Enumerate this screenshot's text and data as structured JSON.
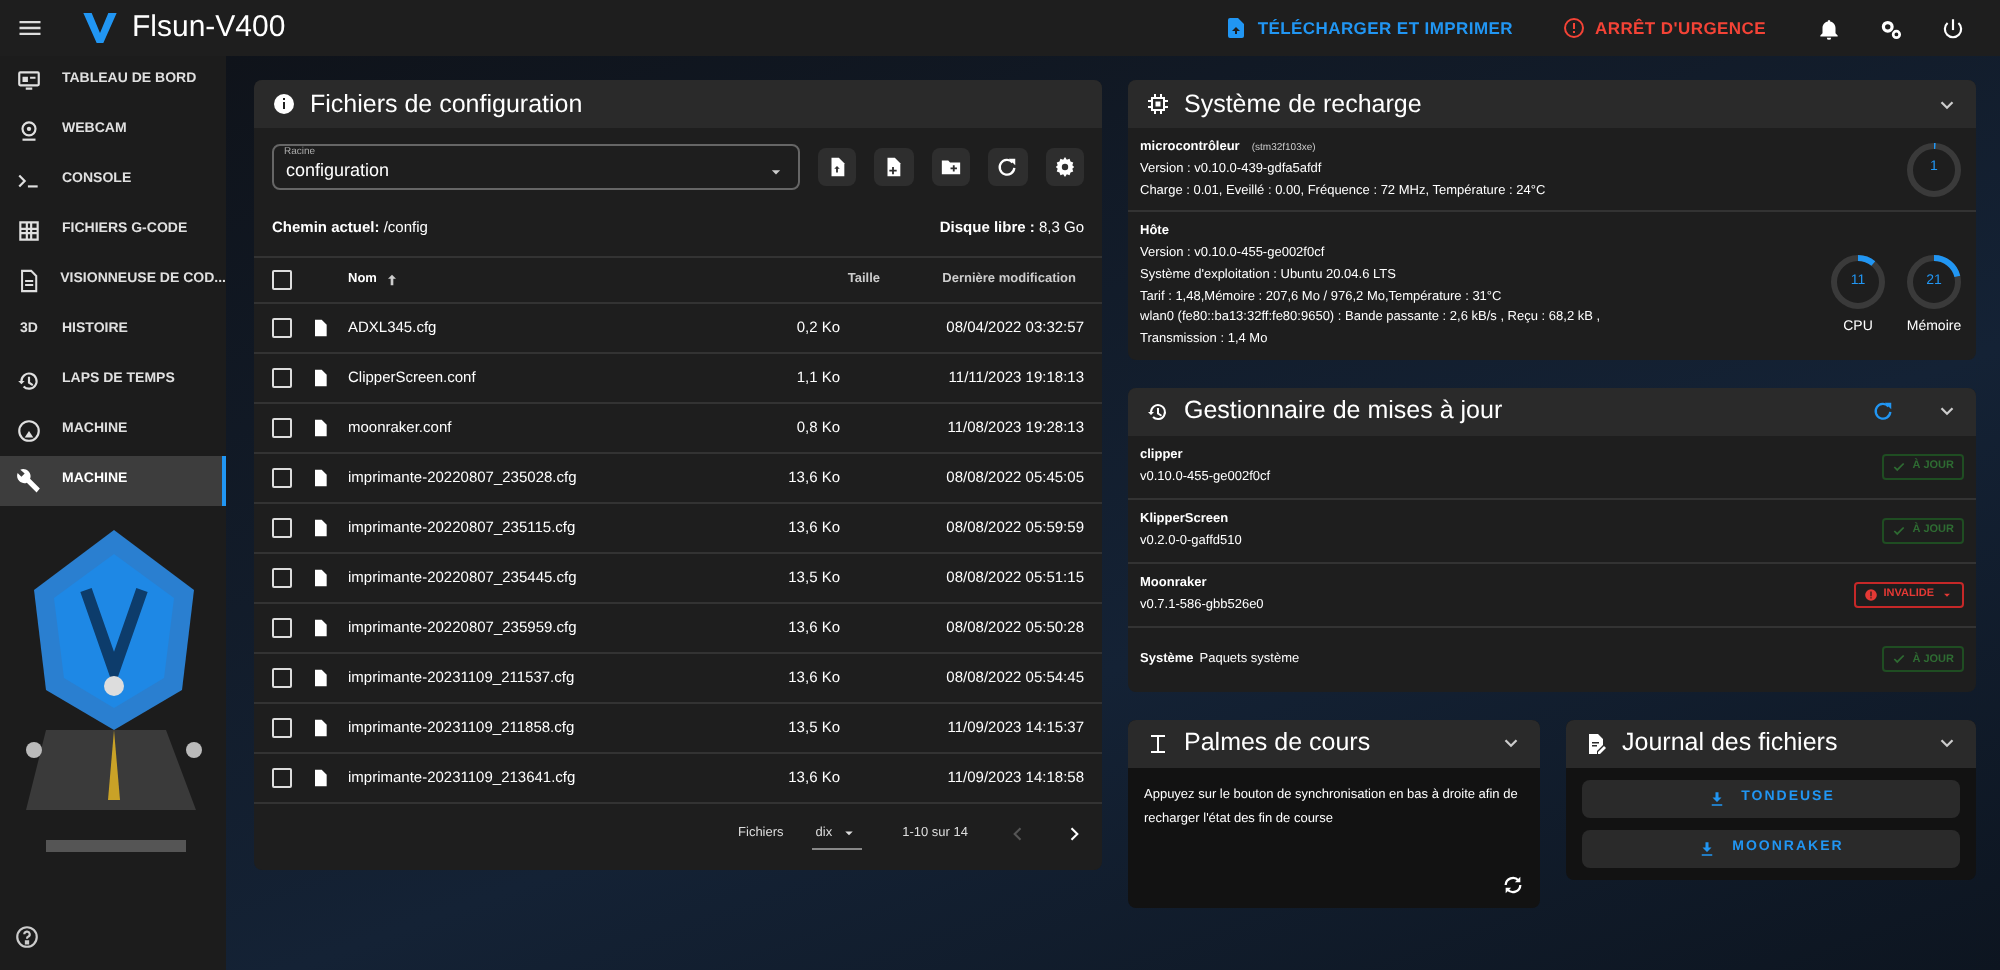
{
  "app": {
    "title": "Flsun-V400"
  },
  "top_actions": [
    {
      "label": "TÉLÉCHARGER ET IMPRIMER",
      "kind": "upload"
    },
    {
      "label": "ARRÊT D'URGENCE",
      "kind": "stop"
    }
  ],
  "sidebar": {
    "items": [
      {
        "label": "TABLEAU DE BORD",
        "selected": false
      },
      {
        "label": "WEBCAM",
        "selected": false
      },
      {
        "label": "CONSOLE",
        "selected": false
      },
      {
        "label": "FICHIERS G-CODE",
        "selected": false
      },
      {
        "label": "VISIONNEUSE DE COD...",
        "selected": false
      },
      {
        "label": "HISTOIRE",
        "icon_text": "3D",
        "selected": false
      },
      {
        "label": "LAPS DE TEMPS",
        "selected": false
      },
      {
        "label": "MACHINE",
        "selected": false
      },
      {
        "label": "MACHINE",
        "selected": true
      }
    ]
  },
  "files_panel": {
    "title": "Fichiers de configuration",
    "root_select": {
      "label": "Racine",
      "value": "configuration"
    },
    "current_path_label": "Chemin actuel:",
    "current_path": "/config",
    "free_disk_label": "Disque libre :",
    "free_disk": "8,3 Go",
    "table": {
      "select_all_checked": false,
      "columns": [
        {
          "label": "Nom",
          "sorted": true
        },
        {
          "label": "Taille",
          "sorted": false
        },
        {
          "label": "Dernière modification",
          "sorted": false
        }
      ],
      "rows": [
        {
          "name": "ADXL345.cfg",
          "size": "0,2 Ko",
          "modified": "08/04/2022 03:32:57",
          "checked": false
        },
        {
          "name": "ClipperScreen.conf",
          "size": "1,1 Ko",
          "modified": "11/11/2023 19:18:13",
          "checked": false
        },
        {
          "name": "moonraker.conf",
          "size": "0,8 Ko",
          "modified": "11/08/2023 19:28:13",
          "checked": false
        },
        {
          "name": "imprimante-20220807_235028.cfg",
          "size": "13,6 Ko",
          "modified": "08/08/2022 05:45:05",
          "checked": false
        },
        {
          "name": "imprimante-20220807_235115.cfg",
          "size": "13,6 Ko",
          "modified": "08/08/2022 05:59:59",
          "checked": false
        },
        {
          "name": "imprimante-20220807_235445.cfg",
          "size": "13,5 Ko",
          "modified": "08/08/2022 05:51:15",
          "checked": false
        },
        {
          "name": "imprimante-20220807_235959.cfg",
          "size": "13,6 Ko",
          "modified": "08/08/2022 05:50:28",
          "checked": false
        },
        {
          "name": "imprimante-20231109_211537.cfg",
          "size": "13,6 Ko",
          "modified": "08/08/2022 05:54:45",
          "checked": false
        },
        {
          "name": "imprimante-20231109_211858.cfg",
          "size": "13,5 Ko",
          "modified": "11/09/2023 14:15:37",
          "checked": false
        },
        {
          "name": "imprimante-20231109_213641.cfg",
          "size": "13,6 Ko",
          "modified": "11/09/2023 14:18:58",
          "checked": false
        }
      ]
    },
    "footer": {
      "rows_label": "Fichiers",
      "rows_per_page": "dix",
      "range": "1-10 sur 14"
    }
  },
  "system_panel": {
    "title": "Système de recharge",
    "mcu": {
      "name": "microcontrôleur",
      "chip": "(stm32f103xe)",
      "lines": [
        "Version : v0.10.0-439-gdfa5afdf",
        "Charge : 0.01, Eveillé : 0.00, Fréquence : 72 MHz, Température : 24°C"
      ],
      "gauge": {
        "value": "1",
        "level": 0.01
      }
    },
    "host": {
      "name": "Hôte",
      "lines": [
        "Version : v0.10.0-455-ge002f0cf",
        "Système d'exploitation : Ubuntu 20.04.6 LTS",
        "Tarif : 1,48,Mémoire : 207,6 Mo / 976,2 Mo,Température : 31°C",
        "wlan0 (fe80::ba13:32ff:fe80:9650) : Bande passante : 2,6 kB/s , Reçu : 68,2 kB ,",
        "Transmission : 1,4 Mo"
      ],
      "gauges": [
        {
          "value": "11",
          "label": "CPU",
          "level": 0.11
        },
        {
          "value": "21",
          "label": "Mémoire",
          "level": 0.21
        }
      ]
    }
  },
  "update_panel": {
    "title": "Gestionnaire de mises à jour",
    "items": [
      {
        "name": "clipper",
        "version": "v0.10.0-455-ge002f0cf",
        "status": "À JOUR",
        "kind": "ok"
      },
      {
        "name": "KlipperScreen",
        "version": "v0.2.0-0-gaffd510",
        "status": "À JOUR",
        "kind": "ok"
      },
      {
        "name": "Moonraker",
        "version": "v0.7.1-586-gbb526e0",
        "status": "INVALIDE",
        "kind": "invalid"
      },
      {
        "name": "Système",
        "detail": "Paquets système",
        "status": "À JOUR",
        "kind": "ok"
      }
    ]
  },
  "endstops_panel": {
    "title": "Palmes de cours",
    "message": "Appuyez sur le bouton de synchronisation en bas à droite afin de recharger l'état des fin de course"
  },
  "logs_panel": {
    "title": "Journal des fichiers",
    "buttons": [
      "TONDEUSE",
      "MOONRAKER"
    ]
  }
}
